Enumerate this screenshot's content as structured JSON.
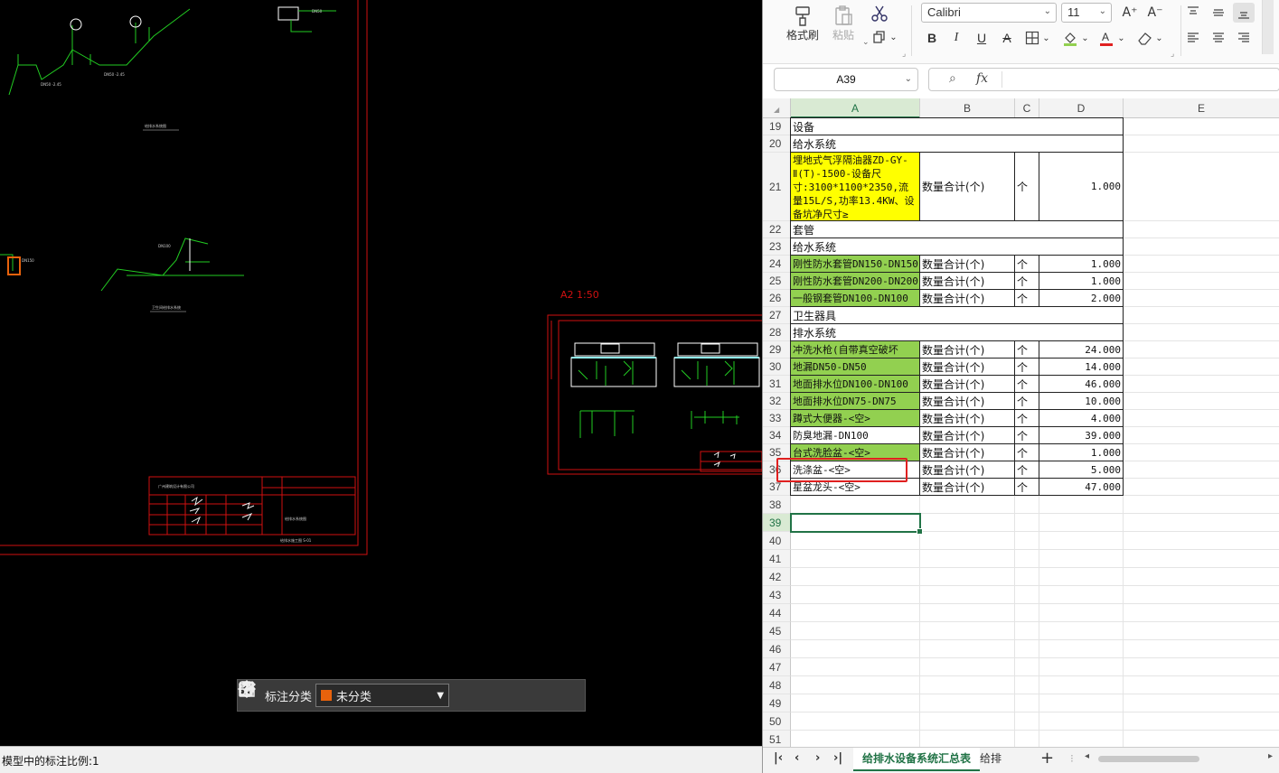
{
  "cad": {
    "toolbar": {
      "label": "标注分类",
      "category_value": "未分类",
      "category_color": "#e8620c"
    },
    "status_text": "模型中的标注比例:1",
    "view_label": "A2  1:50"
  },
  "ribbon": {
    "format_painter": "格式刷",
    "paste": "粘贴",
    "font_name": "Calibri",
    "font_size": "11",
    "increase_font": "A⁺",
    "decrease_font": "A⁻",
    "bold": "B",
    "italic": "I",
    "underline": "U",
    "strike": "A",
    "font_color": "#e02020",
    "fill_color": "#92d050"
  },
  "formula": {
    "name_box": "A39",
    "fx": "fx",
    "value": ""
  },
  "columns": [
    "A",
    "B",
    "C",
    "D",
    "E"
  ],
  "rows": [
    {
      "n": "19",
      "a": "设备"
    },
    {
      "n": "20",
      "a": "给水系统"
    },
    {
      "n": "21",
      "a": "埋地式气浮隔油器ZD-GY-Ⅱ(T)-1500-设备尺寸:3100*1100*2350,流量15L/S,功率13.4KW、设备坑净尺寸≥",
      "b": "数量合计(个)",
      "c": "个",
      "d": "1.000",
      "fill": "yellow"
    },
    {
      "n": "22",
      "a": "套管"
    },
    {
      "n": "23",
      "a": "给水系统"
    },
    {
      "n": "24",
      "a": "刚性防水套管DN150-DN150",
      "b": "数量合计(个)",
      "c": "个",
      "d": "1.000",
      "fill": "green"
    },
    {
      "n": "25",
      "a": "刚性防水套管DN200-DN200",
      "b": "数量合计(个)",
      "c": "个",
      "d": "1.000",
      "fill": "green"
    },
    {
      "n": "26",
      "a": "一般钢套管DN100-DN100",
      "b": "数量合计(个)",
      "c": "个",
      "d": "2.000",
      "fill": "green"
    },
    {
      "n": "27",
      "a": "卫生器具"
    },
    {
      "n": "28",
      "a": "排水系统"
    },
    {
      "n": "29",
      "a": "冲洗水枪(自带真空破坏",
      "b": "数量合计(个)",
      "c": "个",
      "d": "24.000",
      "fill": "green"
    },
    {
      "n": "30",
      "a": "地漏DN50-DN50",
      "b": "数量合计(个)",
      "c": "个",
      "d": "14.000",
      "fill": "green"
    },
    {
      "n": "31",
      "a": "地面排水位DN100-DN100",
      "b": "数量合计(个)",
      "c": "个",
      "d": "46.000",
      "fill": "green"
    },
    {
      "n": "32",
      "a": "地面排水位DN75-DN75",
      "b": "数量合计(个)",
      "c": "个",
      "d": "10.000",
      "fill": "green"
    },
    {
      "n": "33",
      "a": "蹲式大便器-<空>",
      "b": "数量合计(个)",
      "c": "个",
      "d": "4.000",
      "fill": "green"
    },
    {
      "n": "34",
      "a": "防臭地漏-DN100",
      "b": "数量合计(个)",
      "c": "个",
      "d": "39.000"
    },
    {
      "n": "35",
      "a": "台式洗脸盆-<空>",
      "b": "数量合计(个)",
      "c": "个",
      "d": "1.000",
      "fill": "green"
    },
    {
      "n": "36",
      "a": "洗涤盆-<空>",
      "b": "数量合计(个)",
      "c": "个",
      "d": "5.000"
    },
    {
      "n": "37",
      "a": "星盆龙头-<空>",
      "b": "数量合计(个)",
      "c": "个",
      "d": "47.000"
    },
    {
      "n": "38"
    },
    {
      "n": "39"
    },
    {
      "n": "40"
    },
    {
      "n": "41"
    },
    {
      "n": "42"
    },
    {
      "n": "43"
    },
    {
      "n": "44"
    },
    {
      "n": "45"
    },
    {
      "n": "46"
    },
    {
      "n": "47"
    },
    {
      "n": "48"
    },
    {
      "n": "49"
    },
    {
      "n": "50"
    },
    {
      "n": "51"
    }
  ],
  "selected_row": "39",
  "sheet_tabs": {
    "active": "给排水设备系统汇总表",
    "other": "给排水"
  }
}
